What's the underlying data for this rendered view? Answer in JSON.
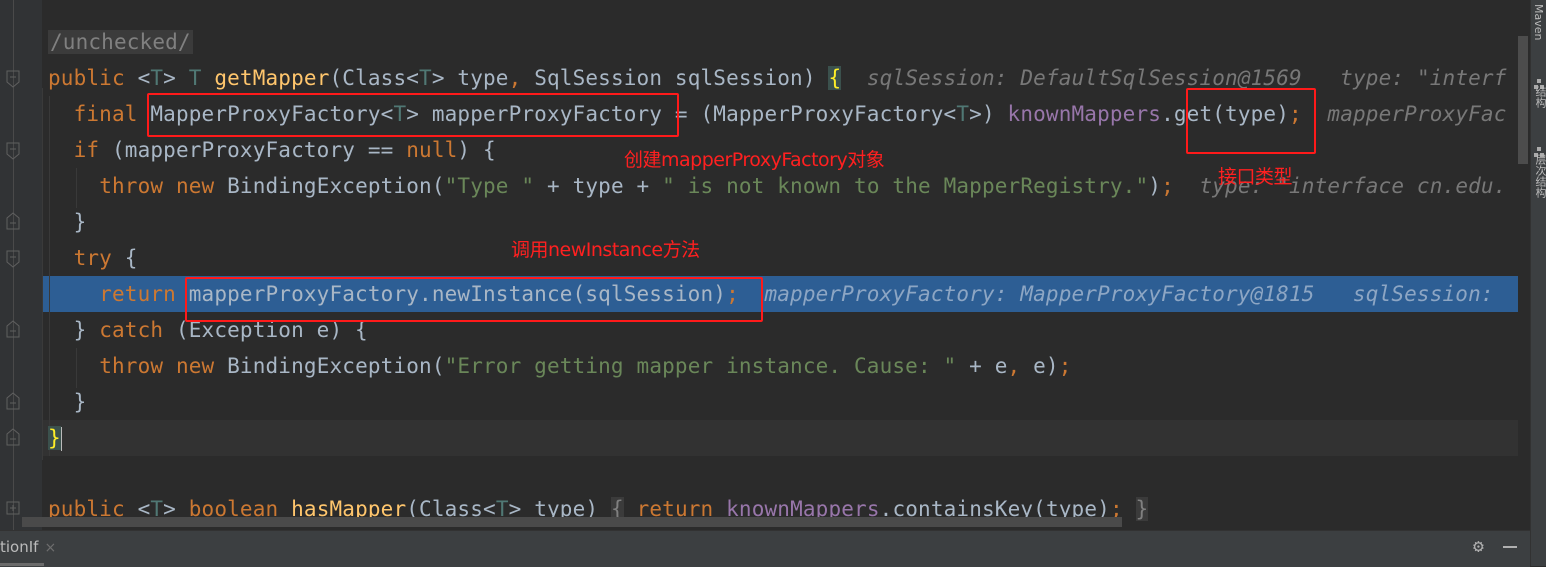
{
  "editor": {
    "lines": {
      "l1": {
        "annotation": "/unchecked/"
      },
      "l2": {
        "kw_public": "public",
        "generic_open": "<",
        "tp1": "T",
        "generic_close": ">",
        "tp2": "T",
        "method": "getMapper",
        "params_a": "(Class<",
        "tp3": "T",
        "params_b": "> type",
        "comma": ",",
        "params_c": " SqlSession sqlSession) ",
        "brace": "{",
        "hint": "sqlSession: DefaultSqlSession@1569   type: \"interf"
      },
      "l3": {
        "kw_final": "final",
        "decl_a": "MapperProxyFactory<",
        "tp": "T",
        "decl_b": "> mapperProxyFactory",
        "assign_a": " = (MapperProxyFactory<",
        "tp2": "T",
        "assign_b": ">) ",
        "field": "knownMappers",
        "dot": ".",
        "call": "get(type)",
        "semi": ";",
        "hint": "mapperProxyFac"
      },
      "l4": {
        "kw_if": "if",
        "cond_a": " (mapperProxyFactory == ",
        "kw_null": "null",
        "cond_b": ") {"
      },
      "l5": {
        "kw_throw": "throw",
        "kw_new": "new",
        "ctor": " BindingException(",
        "str1": "\"Type \"",
        "mid": " + type + ",
        "str2": "\" is not known to the MapperRegistry.\"",
        "close": ")",
        "semi": ";",
        "hint": "type: \"interface cn.edu."
      },
      "l6": {
        "text": "}"
      },
      "l7": {
        "kw_try": "try",
        "rest": " {"
      },
      "l8": {
        "kw_return": "return",
        "expr": "mapperProxyFactory.newInstance(sqlSession)",
        "semi": ";",
        "hint": "mapperProxyFactory: MapperProxyFactory@1815   sqlSession:"
      },
      "l9": {
        "close": "} ",
        "kw_catch": "catch",
        "rest": " (Exception e) {"
      },
      "l10": {
        "kw_throw": "throw",
        "kw_new": "new",
        "ctor": " BindingException(",
        "str": "\"Error getting mapper instance. Cause: \"",
        "rest_a": " + e",
        "comma": ",",
        "rest_b": " e)",
        "semi": ";"
      },
      "l11": {
        "text": "}"
      },
      "l12": {
        "brace": "}"
      },
      "l13": {
        "kw_public": "public",
        "lt": "<",
        "tp": "T",
        "gt": ">",
        "kw_boolean": "boolean",
        "method": "hasMapper",
        "params_a": "(Class<",
        "tp2": "T",
        "params_b": "> type) ",
        "open": "{",
        "kw_return": "return",
        "field": "knownMappers",
        "call": ".containsKey(type)",
        "semi": ";",
        "close": "}"
      }
    }
  },
  "annotations": {
    "create_factory": "创建mapperProxyFactory对象",
    "interface_type": "接口类型",
    "call_new_instance": "调用newInstance方法"
  },
  "right_toolbar": {
    "maven": "Maven",
    "structure": "结构",
    "hierarchy": "层次结构"
  },
  "bottom_panel": {
    "tab_label": "tionIf",
    "close_icon": "×",
    "gear_icon": "⚙"
  },
  "colors": {
    "annotation_red": "#ff2020",
    "execution_line": "#2d5e94",
    "keyword": "#cc7832",
    "string": "#6a8759"
  }
}
